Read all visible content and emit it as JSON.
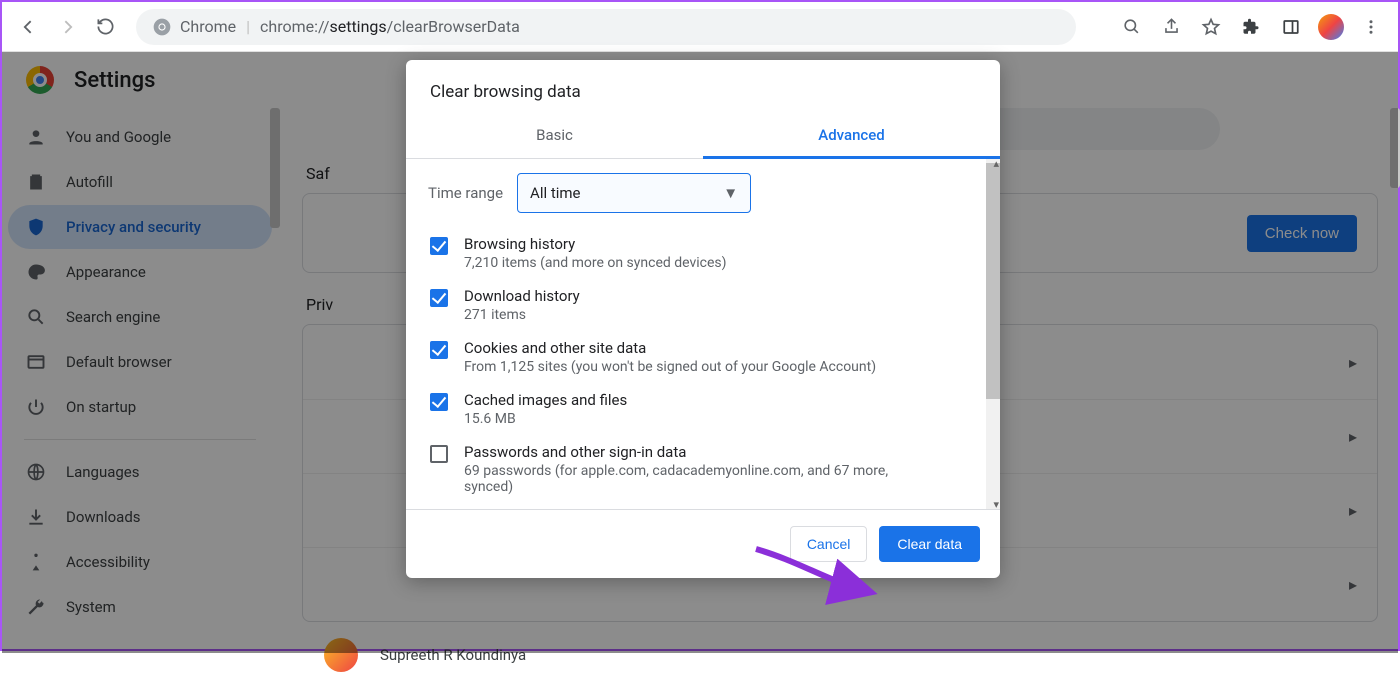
{
  "toolbar": {
    "chip_label": "Chrome",
    "url_prefix": "chrome://",
    "url_mid": "settings",
    "url_suffix": "/clearBrowserData"
  },
  "header": {
    "title": "Settings"
  },
  "sidebar": {
    "items": [
      {
        "label": "You and Google"
      },
      {
        "label": "Autofill"
      },
      {
        "label": "Privacy and security"
      },
      {
        "label": "Appearance"
      },
      {
        "label": "Search engine"
      },
      {
        "label": "Default browser"
      },
      {
        "label": "On startup"
      }
    ],
    "items2": [
      {
        "label": "Languages"
      },
      {
        "label": "Downloads"
      },
      {
        "label": "Accessibility"
      },
      {
        "label": "System"
      }
    ]
  },
  "main": {
    "section1": "Saf",
    "check_now": "Check now",
    "section2": "Priv",
    "user_name": "Supreeth R Koundinya"
  },
  "dialog": {
    "title": "Clear browsing data",
    "tab_basic": "Basic",
    "tab_advanced": "Advanced",
    "time_label": "Time range",
    "time_value": "All time",
    "options": [
      {
        "checked": true,
        "title": "Browsing history",
        "sub": "7,210 items (and more on synced devices)"
      },
      {
        "checked": true,
        "title": "Download history",
        "sub": "271 items"
      },
      {
        "checked": true,
        "title": "Cookies and other site data",
        "sub": "From 1,125 sites (you won't be signed out of your Google Account)"
      },
      {
        "checked": true,
        "title": "Cached images and files",
        "sub": "15.6 MB"
      },
      {
        "checked": false,
        "title": "Passwords and other sign-in data",
        "sub": "69 passwords (for apple.com, cadacademyonline.com, and 67 more, synced)"
      }
    ],
    "cancel": "Cancel",
    "clear": "Clear data"
  }
}
